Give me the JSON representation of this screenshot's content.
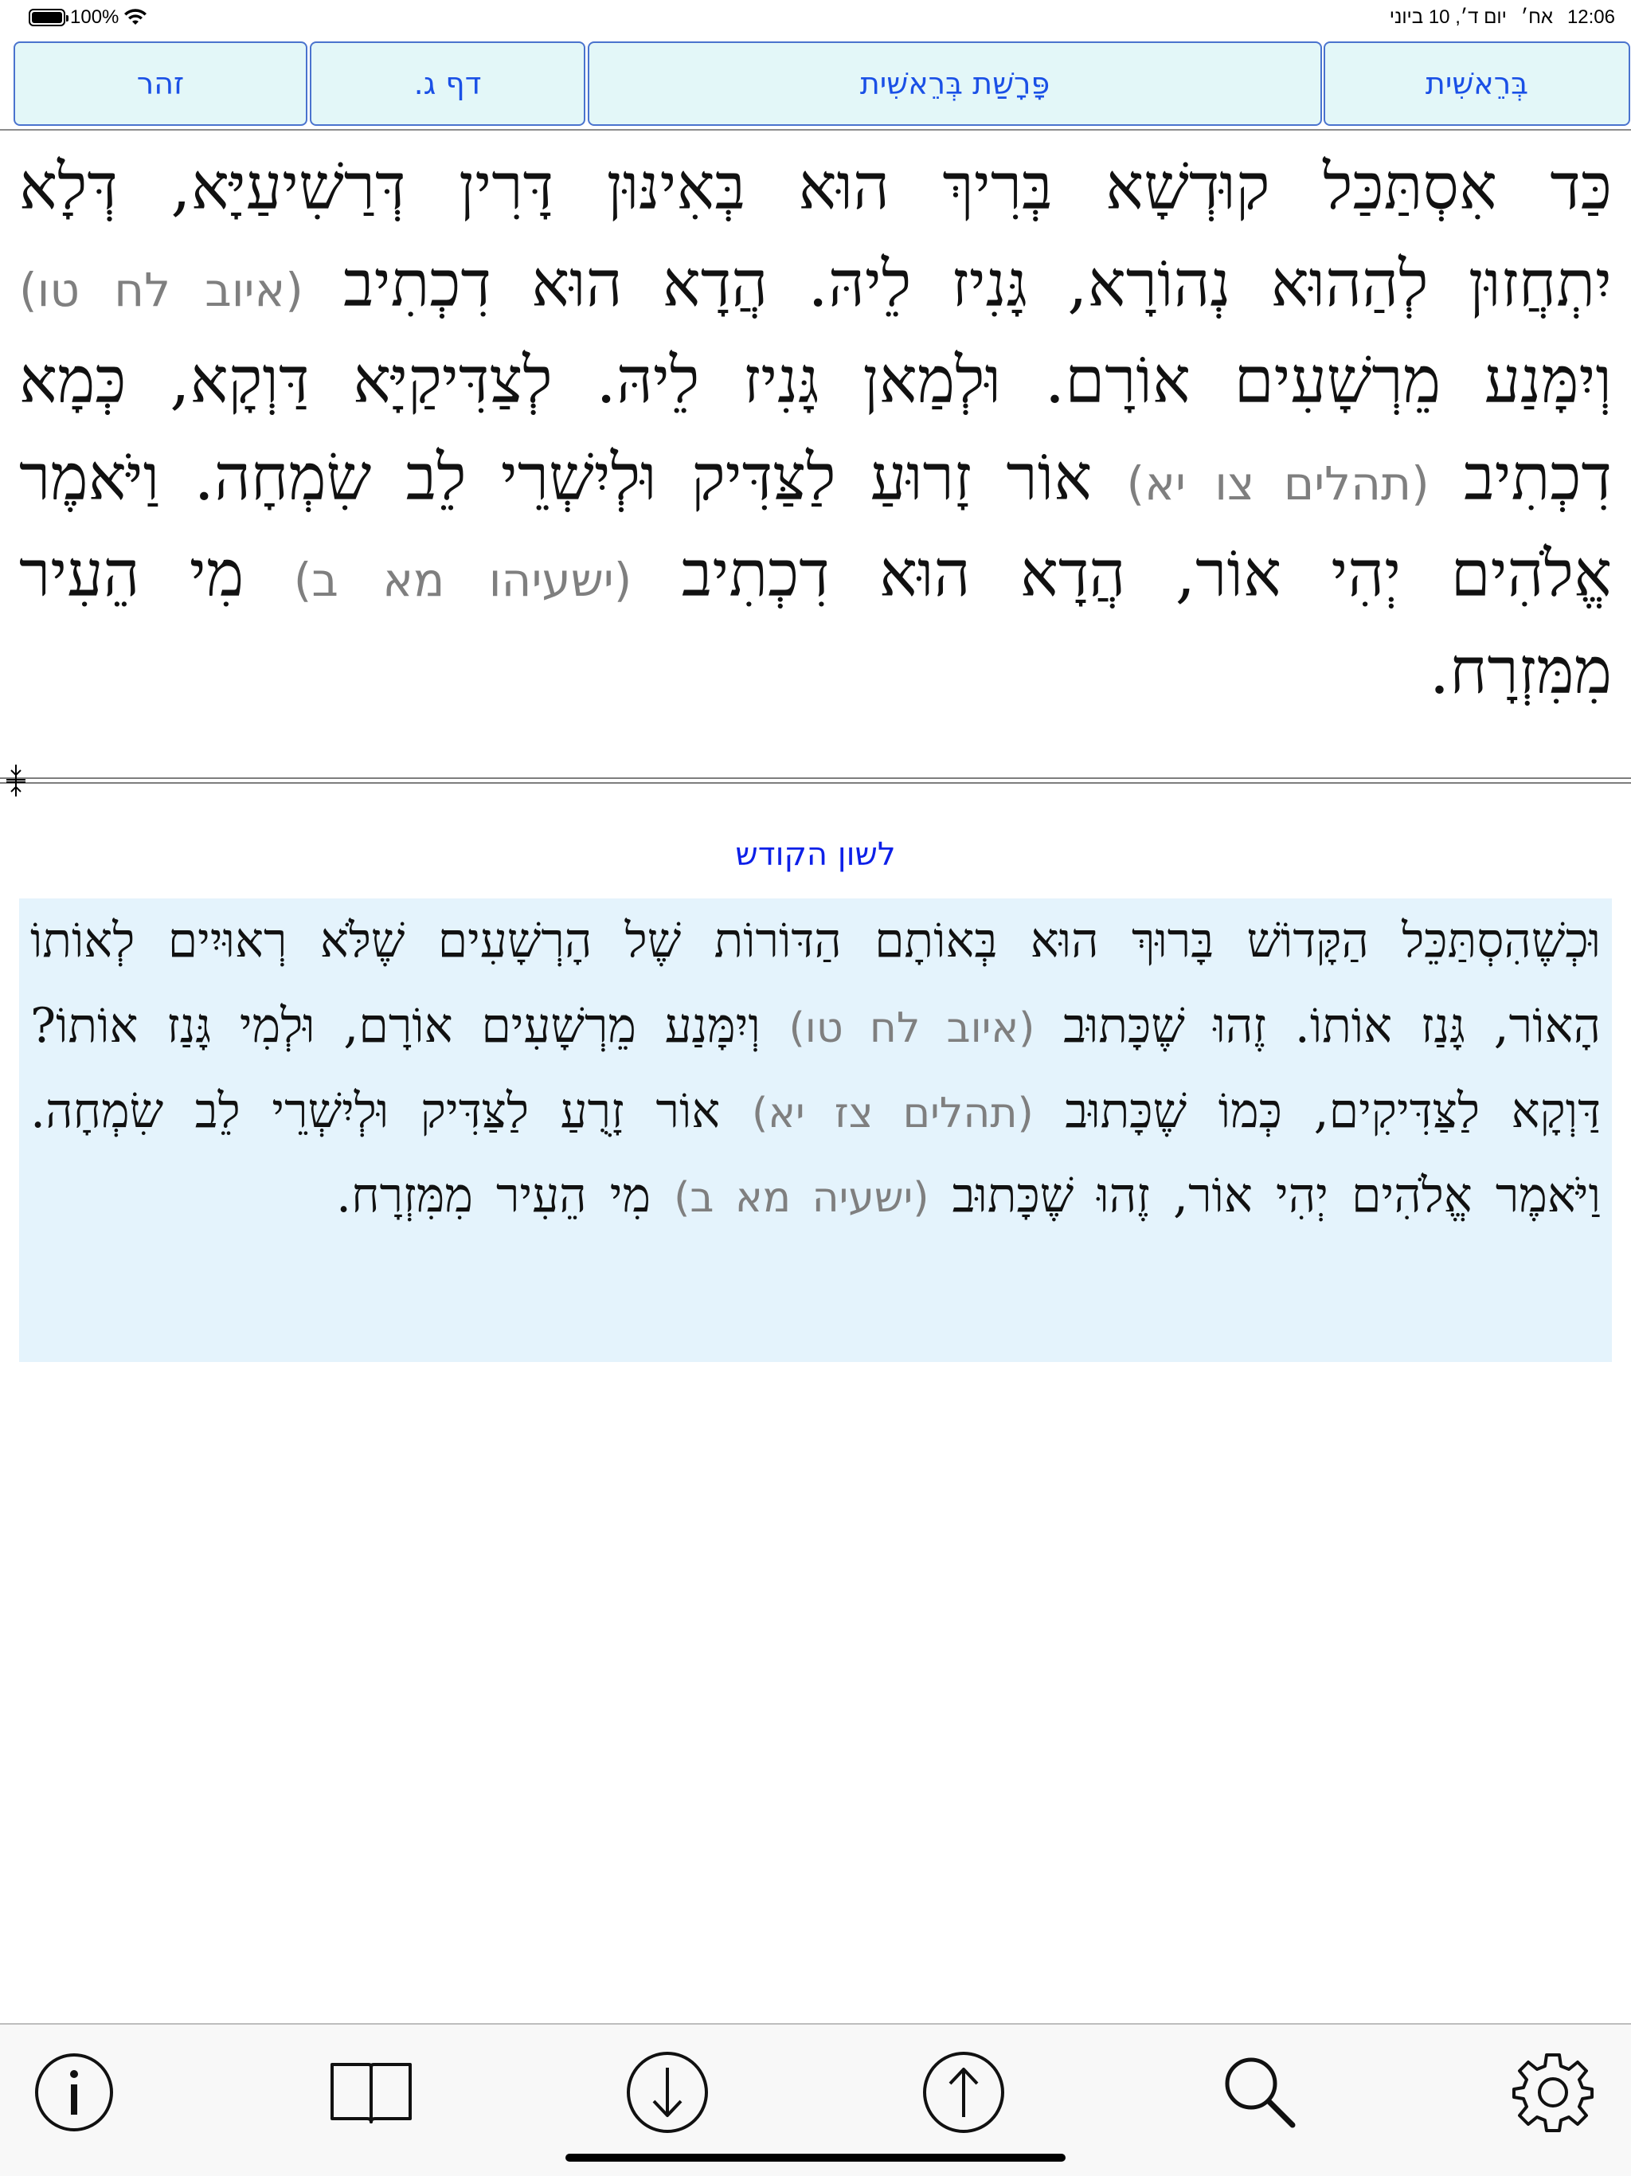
{
  "status": {
    "battery": "100%",
    "time": "12:06",
    "period": "אח׳",
    "date": "יום ד׳, 10 ביוני"
  },
  "nav": {
    "book": "בְּרֵאשִׁית",
    "parasha": "פָּרָשַׁת בְּרֵאשִׁית",
    "page": "דף ג.",
    "zohar": "זהר"
  },
  "aramaic": {
    "t1": "כַּד אִסְתַּכַּל קוּדְשָׁא בְּרִיךְ הוּא בְּאִינּוּן דָּרִין דְּרַשִׁיעַיָּא, דְּלָא יִתְחֲזוּן לְהַהוּא נְהוֹרָא, גָּנִיז לֵיהּ. הֲדָא הוּא דִכְתִיב",
    "ref1": "(איוב לח טו)",
    "t2": "וְיִמָּנַע מֵרְשָׁעִים אוֹרָם. וּלְמַאן גָּנִיז לֵיהּ. לְצַדִּיקַיָּא דַּוְקָא, כְּמָא דִכְתִיב",
    "ref2": "(תהלים צו יא)",
    "t3": "אוֹר זָרוּעַ לַצַּדִּיק וּלְיִשְׁרֵי לֵב שִׂמְחָה. וַיֹּאמֶר אֱלֹהִים יְהִי אוֹר, הֲדָא הוּא דִכְתִיב",
    "ref3": "(ישעיהו מא ב)",
    "t4": "מִי הֵעִיר מִמִּזְרָח."
  },
  "translation": {
    "label": "לשון הקודש",
    "t1": "וּכְשֶׁהִסְתַּכֵּל הַקָּדוֹשׁ בָּרוּךְ הוּא בְּאוֹתָם הַדּוֹרוֹת שֶׁל הָרְשָׁעִים שֶׁלֹּא רְאוּיִים לְאוֹתוֹ הָאוֹר, גָּנַז אוֹתוֹ. זֶהוּ שֶׁכָּתוּב",
    "ref1": "(איוב לח טו)",
    "t2": "וְיִמָּנַע מֵרְשָׁעִים אוֹרָם, וּלְמִי גָּנַז אוֹתוֹ? דַּוְקָא לַצַּדִּיקִים, כְּמוֹ שֶׁכָּתוּב",
    "ref2": "(תהלים צז יא)",
    "t3": "אוֹר זָרֻעַ לַצַּדִּיק וּלְיִשְׁרֵי לֵב שִׂמְחָה. וַיֹּאמֶר אֱלֹהִים יְהִי אוֹר, זֶהוּ שֶׁכָּתוּב",
    "ref3": "(ישעיה מא ב)",
    "t4": "מִי הֵעִיר מִמִּזְרָח."
  },
  "colors": {
    "accent": "#1a50e6",
    "nav_bg": "#e3f7f8",
    "translation_bg": "#e4f3fc",
    "reference_text": "#7f7f7f",
    "label_blue": "#0d20e8"
  },
  "toolbar_icons": [
    "info-icon",
    "book-icon",
    "arrow-down-icon",
    "arrow-up-icon",
    "search-icon",
    "gear-icon"
  ]
}
